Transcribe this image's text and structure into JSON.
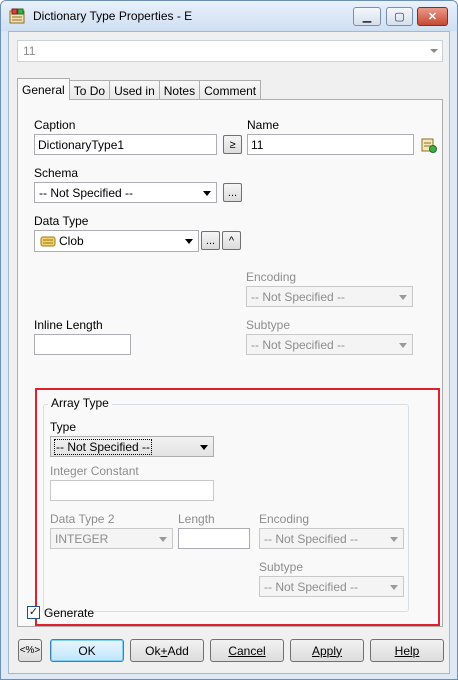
{
  "window": {
    "title": "Dictionary Type Properties - E",
    "controls": {
      "minimize": "▁",
      "maximize": "▢",
      "close": "✕"
    }
  },
  "selector": {
    "value": "11"
  },
  "tabs": [
    {
      "label": "General",
      "active": true
    },
    {
      "label": "To Do",
      "active": false
    },
    {
      "label": "Used in",
      "active": false
    },
    {
      "label": "Notes",
      "active": false
    },
    {
      "label": "Comment",
      "active": false
    }
  ],
  "general": {
    "caption": {
      "label": "Caption",
      "value": "DictionaryType1",
      "copy_button": "≥"
    },
    "name": {
      "label": "Name",
      "value": "11"
    },
    "schema": {
      "label": "Schema",
      "value": "-- Not Specified --",
      "browse_button": "..."
    },
    "data_type": {
      "label": "Data Type",
      "value": "Clob",
      "browse_button": "...",
      "up_button": "^"
    },
    "encoding": {
      "label": "Encoding",
      "value": "-- Not Specified --"
    },
    "inline_length": {
      "label": "Inline Length",
      "value": ""
    },
    "subtype": {
      "label": "Subtype",
      "value": "-- Not Specified --"
    }
  },
  "array_type": {
    "group_label": "Array Type",
    "type": {
      "label": "Type",
      "value": "-- Not Specified --"
    },
    "integer_constant": {
      "label": "Integer Constant",
      "value": ""
    },
    "data_type2": {
      "label": "Data Type 2",
      "value": "INTEGER"
    },
    "length": {
      "label": "Length",
      "value": ""
    },
    "encoding": {
      "label": "Encoding",
      "value": "-- Not Specified --"
    },
    "subtype": {
      "label": "Subtype",
      "value": "-- Not Specified --"
    }
  },
  "generate": {
    "label": "Generate",
    "checked": true
  },
  "buttons": {
    "more": "<%>",
    "ok": "OK",
    "ok_add_prefix": "Ok",
    "ok_add_underline": "+",
    "ok_add_suffix": "Add",
    "cancel": "Cancel",
    "apply": "Apply",
    "help": "Help"
  },
  "colors": {
    "highlight_frame": "#e0202c",
    "titlebar": "#cfdff2"
  },
  "icons": {
    "app": "dictionary-type-icon",
    "data_type": "clob-icon",
    "name_tool": "properties-icon"
  }
}
